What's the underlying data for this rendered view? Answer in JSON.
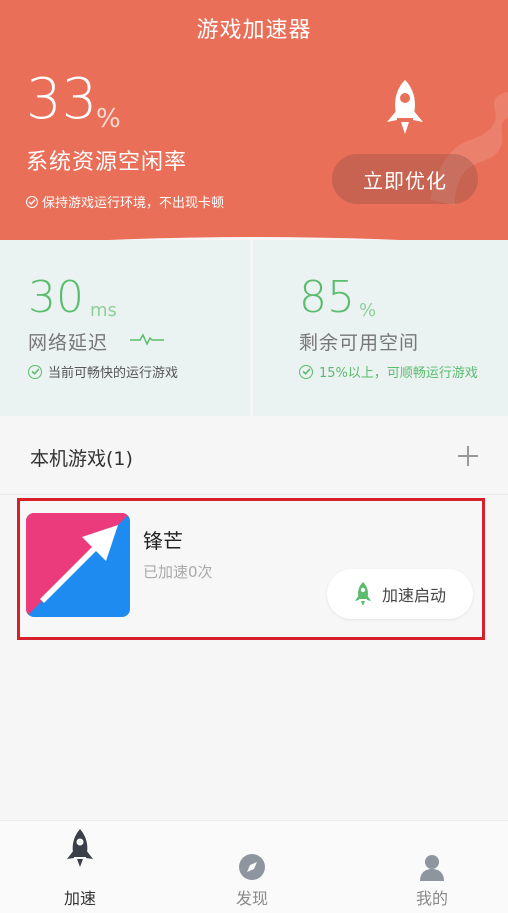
{
  "header": {
    "title": "游戏加速器",
    "idle_rate_value": "33",
    "idle_rate_unit": "%",
    "idle_rate_label": "系统资源空闲率",
    "note": "保持游戏运行环境，不出现卡顿",
    "optimize_button": "立即优化",
    "accent_color": "#e96f58"
  },
  "stats": {
    "latency": {
      "value": "30",
      "unit": "ms",
      "label": "网络延迟",
      "note": "当前可畅快的运行游戏"
    },
    "storage": {
      "value": "85",
      "unit": "%",
      "label": "剩余可用空间",
      "note": "15%以上，可顺畅运行游戏"
    },
    "good_color": "#5bbc6e"
  },
  "local_games": {
    "title": "本机游戏(1)",
    "add_icon": "plus-icon",
    "items": [
      {
        "name": "锋芒",
        "subtitle": "已加速0次",
        "button_label": "加速启动",
        "icon": "fengmang-app-icon"
      }
    ]
  },
  "bottom_nav": {
    "items": [
      {
        "label": "加速",
        "icon": "rocket-icon",
        "active": true
      },
      {
        "label": "发现",
        "icon": "compass-icon",
        "active": false
      },
      {
        "label": "我的",
        "icon": "user-icon",
        "active": false
      }
    ]
  }
}
